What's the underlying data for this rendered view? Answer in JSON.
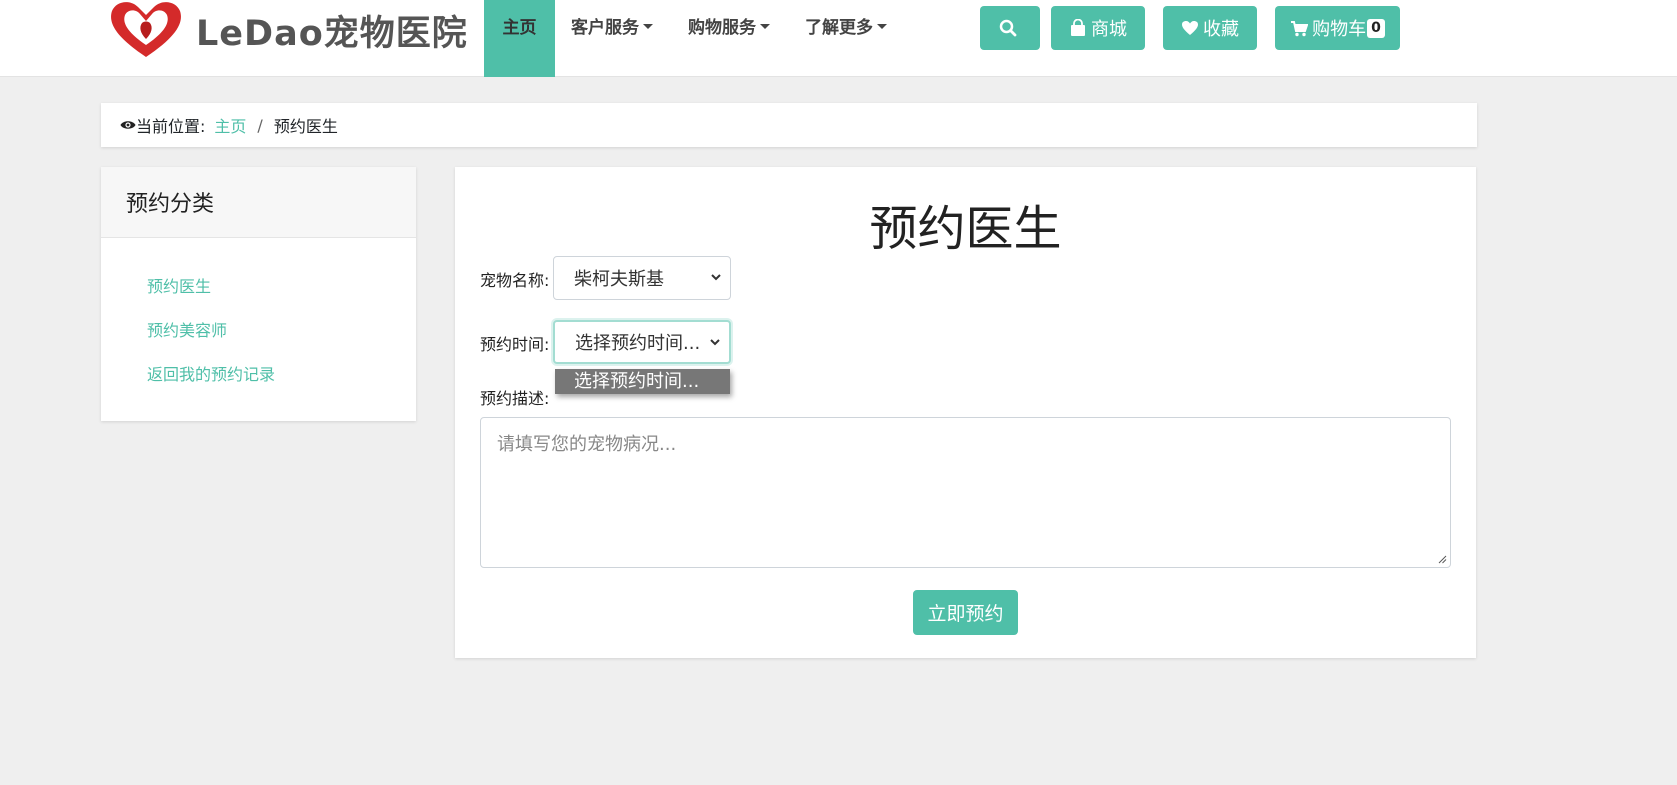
{
  "brand": {
    "name": "LeDao宠物医院",
    "accent": "#4fbfa8"
  },
  "nav": [
    {
      "label": "主页",
      "active": true
    },
    {
      "label": "客户服务"
    },
    {
      "label": "购物服务"
    },
    {
      "label": "了解更多"
    }
  ],
  "toolbar": {
    "search_icon": "search-icon",
    "shop_label": "商城",
    "favorites_label": "收藏",
    "cart_label": "购物车",
    "cart_count": "0"
  },
  "breadcrumb": {
    "prefix": "当前位置:",
    "home": "主页",
    "separator": "/",
    "current": "预约医生"
  },
  "sidebar": {
    "title": "预约分类",
    "items": [
      "预约医生",
      "预约美容师",
      "返回我的预约记录"
    ]
  },
  "form": {
    "title": "预约医生",
    "pet_label": "宠物名称:",
    "pet_value": "柴柯夫斯基",
    "time_label": "预约时间:",
    "time_value": "选择预约时间...",
    "time_options": [
      "选择预约时间..."
    ],
    "desc_label": "预约描述:",
    "desc_placeholder": "请填写您的宠物病况...",
    "submit_label": "立即预约"
  }
}
